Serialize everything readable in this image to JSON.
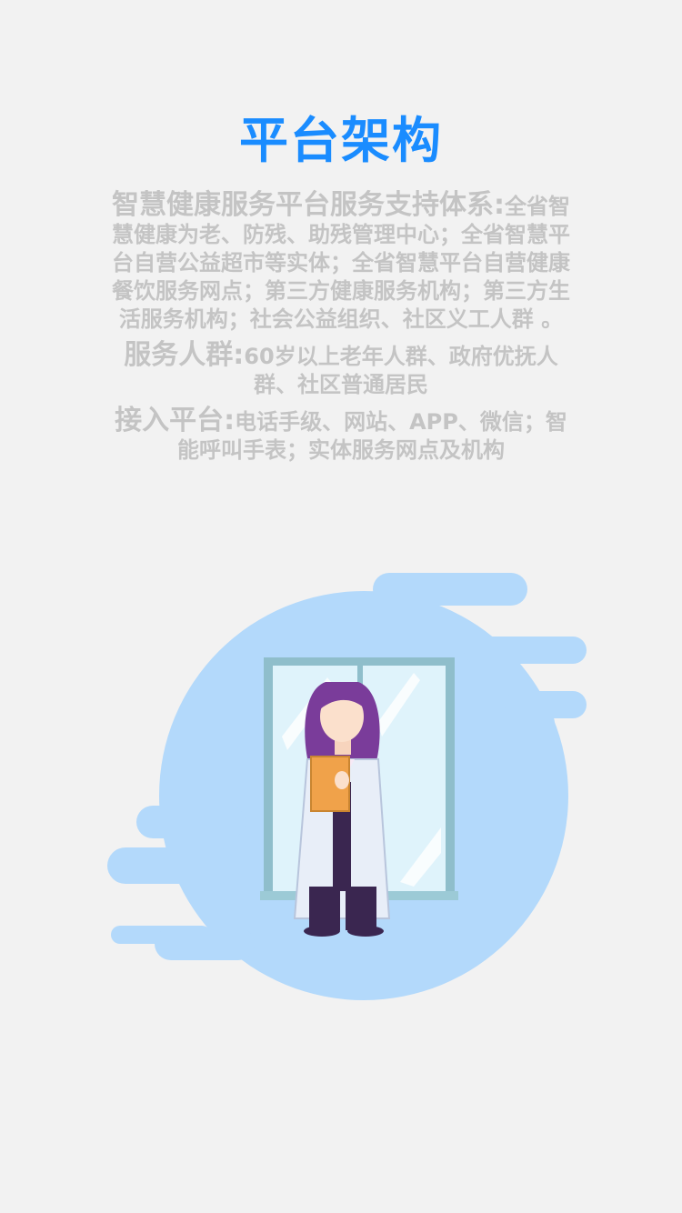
{
  "page": {
    "title": "平台架构",
    "paragraphs": [
      {
        "lead": "智慧健康服务平台服务支持体系:",
        "text": "全省智慧健康为老、防残、助残管理中心；全省智慧平台自营公益超市等实体；全省智慧平台自营健康餐饮服务网点；第三方健康服务机构；第三方生活服务机构；社会公益组织、社区义工人群 。"
      },
      {
        "lead": "服务人群:",
        "text": "60岁以上老年人群、政府优抚人群、社区普通居民"
      },
      {
        "lead": "接入平台:",
        "text": "电话手级、网站、APP、微信；智能呼叫手表；实体服务网点及机构"
      }
    ]
  },
  "colors": {
    "background": "#f2f2f2",
    "title": "#1a8cff",
    "body_text": "#c4c4c4",
    "blob": "#b3d9fb"
  },
  "illustration": {
    "icons": [
      "doctor-figure-icon",
      "window-icon",
      "clipboard-icon"
    ]
  }
}
